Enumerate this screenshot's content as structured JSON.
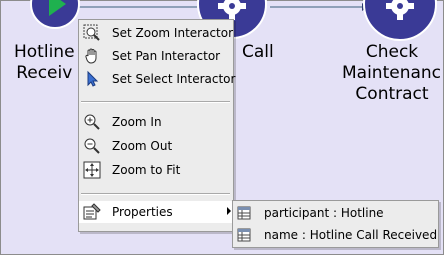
{
  "workflow": {
    "nodes": [
      {
        "label_line1": "Hotline",
        "label_line2": "Receiv"
      },
      {
        "label_line1": "Call"
      },
      {
        "label_line1": "Check",
        "label_line2": "Maintenanc",
        "label_line3": "Contract"
      }
    ]
  },
  "context_menu": {
    "items": [
      {
        "label": "Set Zoom Interactor",
        "icon": "zoom-box-icon"
      },
      {
        "label": "Set Pan Interactor",
        "icon": "hand-icon"
      },
      {
        "label": "Set Select Interactor",
        "icon": "pointer-arrow-icon"
      },
      {
        "label": "Zoom In",
        "icon": "zoom-in-icon"
      },
      {
        "label": "Zoom Out",
        "icon": "zoom-out-icon"
      },
      {
        "label": "Zoom to Fit",
        "icon": "zoom-fit-icon"
      },
      {
        "label": "Properties",
        "icon": "properties-icon"
      }
    ]
  },
  "properties_submenu": {
    "items": [
      {
        "label": "participant : Hotline",
        "icon": "table-icon"
      },
      {
        "label": "name : Hotline Call Received",
        "icon": "table-icon"
      }
    ]
  },
  "colors": {
    "canvas_bg": "#e4e1f6",
    "node_fill": "#3a3a96",
    "node_ring": "#ffffff",
    "connector": "#8fa0b8",
    "menu_bg": "#ececec"
  }
}
